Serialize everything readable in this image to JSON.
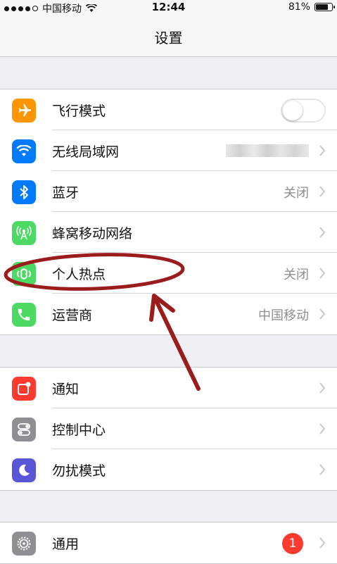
{
  "status_bar": {
    "carrier": "中国移动",
    "time": "12:44",
    "battery_percent": "81%",
    "battery_level": 0.81,
    "signal_bars": 4
  },
  "nav": {
    "title": "设置"
  },
  "groups": [
    {
      "rows": [
        {
          "label": "飞行模式",
          "icon": "airplane-icon",
          "color": "#ff9500",
          "toggle_on": false
        },
        {
          "label": "无线局域网",
          "icon": "wifi-icon",
          "color": "#007aff"
        },
        {
          "label": "蓝牙",
          "icon": "bluetooth-icon",
          "color": "#007aff",
          "value": "关闭"
        },
        {
          "label": "蜂窝移动网络",
          "icon": "cellular-icon",
          "color": "#4cd964"
        },
        {
          "label": "个人热点",
          "icon": "hotspot-icon",
          "color": "#4cd964",
          "value": "关闭"
        },
        {
          "label": "运营商",
          "icon": "phone-icon",
          "color": "#4cd964",
          "value": "中国移动"
        }
      ]
    },
    {
      "rows": [
        {
          "label": "通知",
          "icon": "notifications-icon",
          "color": "#ff3b30"
        },
        {
          "label": "控制中心",
          "icon": "control-center-icon",
          "color": "#8e8e93"
        },
        {
          "label": "勿扰模式",
          "icon": "moon-icon",
          "color": "#5856d6"
        }
      ]
    },
    {
      "rows": [
        {
          "label": "通用",
          "icon": "gear-icon",
          "color": "#8e8e93",
          "badge": "1"
        }
      ]
    }
  ],
  "annotation_color": "#9b1c1c"
}
